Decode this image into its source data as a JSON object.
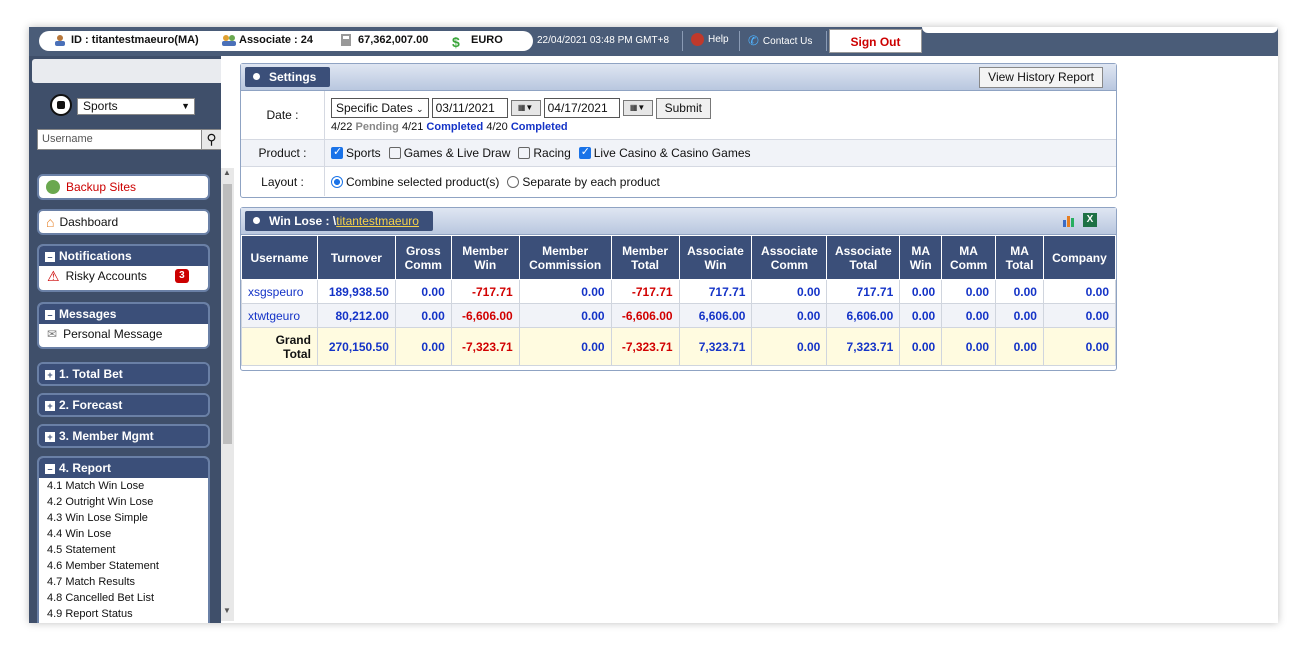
{
  "topbar": {
    "id_label": "ID : titantestmaeuro(MA)",
    "associate": "Associate : 24",
    "balance": "67,362,007.00",
    "currency": "EURO",
    "datetime": "22/04/2021 03:48 PM GMT+8",
    "help": "Help",
    "contact": "Contact Us",
    "signout": "Sign Out"
  },
  "sidebar": {
    "sport_select": "Sports",
    "username_placeholder": "Username",
    "backup_sites": "Backup Sites",
    "dashboard": "Dashboard",
    "notifications": {
      "title": "Notifications",
      "item": "Risky Accounts",
      "count": "3"
    },
    "messages": {
      "title": "Messages",
      "item": "Personal Message"
    },
    "sections": [
      "1. Total Bet",
      "2. Forecast",
      "3. Member Mgmt"
    ],
    "report": {
      "title": "4. Report",
      "items": [
        "4.1 Match Win Lose",
        "4.2 Outright Win Lose",
        "4.3 Win Lose Simple",
        "4.4 Win Lose",
        "4.5 Statement",
        "4.6 Member Statement",
        "4.7 Match Results",
        "4.8 Cancelled Bet List",
        "4.9 Report Status"
      ]
    }
  },
  "settings": {
    "title": "Settings",
    "history_button": "View History Report",
    "date_label": "Date :",
    "date_mode": "Specific Dates",
    "date_from": "03/11/2021",
    "date_to": "04/17/2021",
    "submit": "Submit",
    "status": [
      {
        "date": "4/22",
        "status": "Pending"
      },
      {
        "date": "4/21",
        "status": "Completed"
      },
      {
        "date": "4/20",
        "status": "Completed"
      }
    ],
    "product_label": "Product :",
    "products": [
      {
        "label": "Sports",
        "checked": true
      },
      {
        "label": "Games & Live Draw",
        "checked": false
      },
      {
        "label": "Racing",
        "checked": false
      },
      {
        "label": "Live Casino & Casino Games",
        "checked": true
      }
    ],
    "layout_label": "Layout :",
    "layout_options": [
      {
        "label": "Combine selected product(s)",
        "checked": true
      },
      {
        "label": "Separate by each product",
        "checked": false
      }
    ]
  },
  "winlose": {
    "title_prefix": "Win Lose : \\",
    "title_link": "titantestmaeuro",
    "headers": [
      "Username",
      "Turnover",
      "Gross Comm",
      "Member Win",
      "Member Commission",
      "Member Total",
      "Associate Win",
      "Associate Comm",
      "Associate Total",
      "MA Win",
      "MA Comm",
      "MA Total",
      "Company"
    ],
    "rows": [
      [
        "xsgspeuro",
        "189,938.50",
        "0.00",
        "-717.71",
        "0.00",
        "-717.71",
        "717.71",
        "0.00",
        "717.71",
        "0.00",
        "0.00",
        "0.00",
        "0.00"
      ],
      [
        "xtwtgeuro",
        "80,212.00",
        "0.00",
        "-6,606.00",
        "0.00",
        "-6,606.00",
        "6,606.00",
        "0.00",
        "6,606.00",
        "0.00",
        "0.00",
        "0.00",
        "0.00"
      ]
    ],
    "total": [
      "Grand Total",
      "270,150.50",
      "0.00",
      "-7,323.71",
      "0.00",
      "-7,323.71",
      "7,323.71",
      "0.00",
      "7,323.71",
      "0.00",
      "0.00",
      "0.00",
      "0.00"
    ]
  }
}
